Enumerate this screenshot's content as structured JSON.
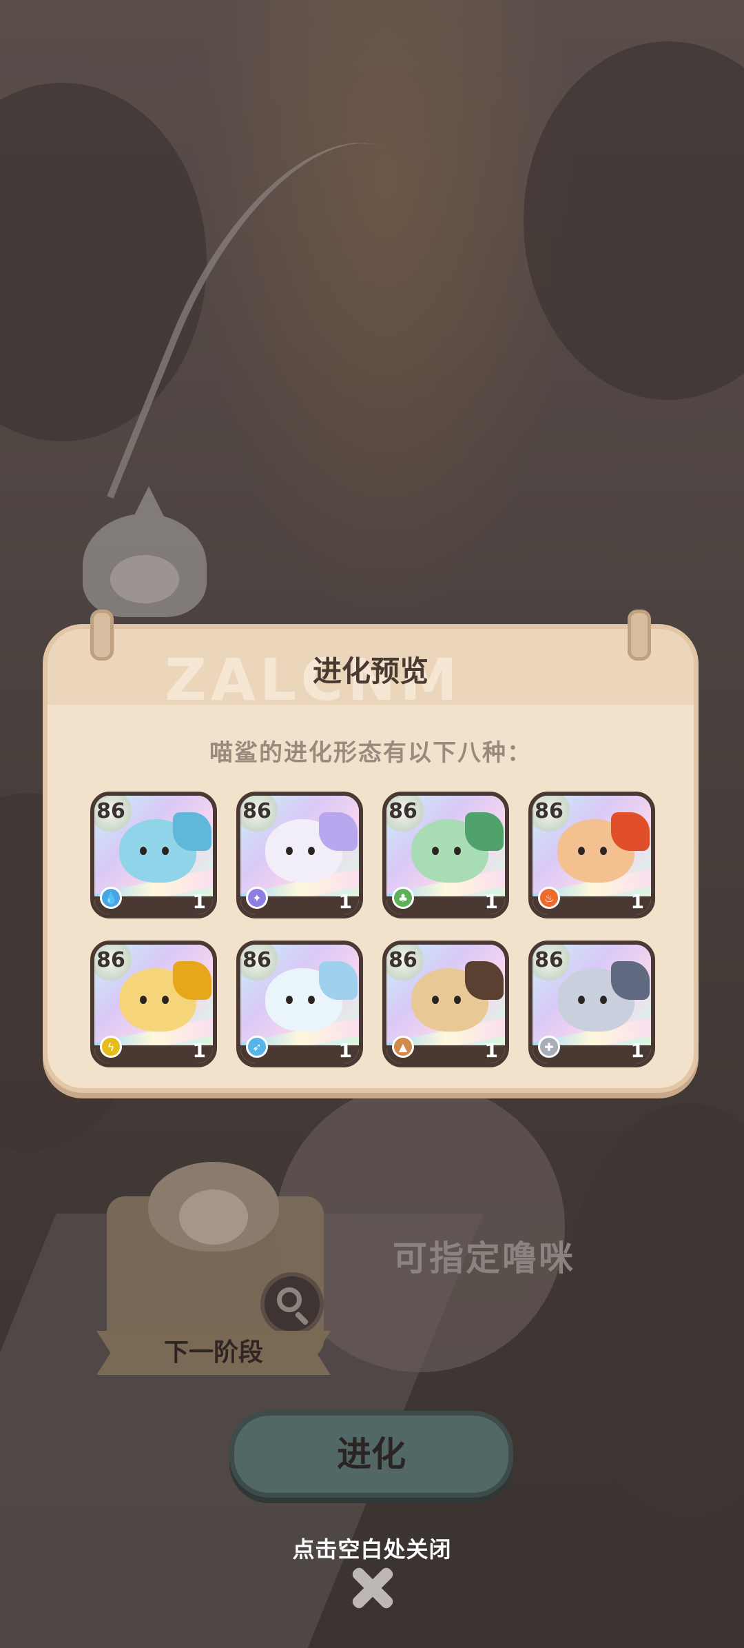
{
  "dialog": {
    "title": "进化预览",
    "watermark": "ZALCNM",
    "subtitle": "喵鲨的进化形态有以下八种："
  },
  "forms": [
    {
      "level": "86",
      "count": "1",
      "element_icon": "water-drop-icon",
      "body_color": "#8fd4e9",
      "accent_color": "#5fb7d9"
    },
    {
      "level": "86",
      "count": "1",
      "element_icon": "sparkle-icon",
      "body_color": "#f2eef8",
      "accent_color": "#b8a6ef"
    },
    {
      "level": "86",
      "count": "1",
      "element_icon": "leaf-icon",
      "body_color": "#a8dcb4",
      "accent_color": "#4fa36a"
    },
    {
      "level": "86",
      "count": "1",
      "element_icon": "fire-icon",
      "body_color": "#f3c08f",
      "accent_color": "#e04f2a"
    },
    {
      "level": "86",
      "count": "1",
      "element_icon": "lightning-icon",
      "body_color": "#f6d57a",
      "accent_color": "#e6a71a"
    },
    {
      "level": "86",
      "count": "1",
      "element_icon": "wing-icon",
      "body_color": "#eaf4fb",
      "accent_color": "#9fd0ee"
    },
    {
      "level": "86",
      "count": "1",
      "element_icon": "rock-icon",
      "body_color": "#e8c995",
      "accent_color": "#5a4030"
    },
    {
      "level": "86",
      "count": "1",
      "element_icon": "normal-star-icon",
      "body_color": "#c9cfdd",
      "accent_color": "#5f6a80"
    }
  ],
  "element_colors": {
    "water-drop-icon": "#4aa4e0",
    "sparkle-icon": "#8d7ee0",
    "leaf-icon": "#5fb05a",
    "fire-icon": "#ec6a2e",
    "lightning-icon": "#e6bb1c",
    "wing-icon": "#56b4e6",
    "rock-icon": "#d08a4a",
    "normal-star-icon": "#a9adb5"
  },
  "element_glyphs": {
    "water-drop-icon": "💧",
    "sparkle-icon": "✦",
    "leaf-icon": "♣",
    "fire-icon": "♨",
    "lightning-icon": "ϟ",
    "wing-icon": "➶",
    "rock-icon": "▲",
    "normal-star-icon": "✚"
  },
  "background": {
    "next_stage_label": "下一阶段",
    "assign_text": "可指定噜咪",
    "evolve_label": "进化"
  },
  "close_hint": "点击空白处关闭"
}
